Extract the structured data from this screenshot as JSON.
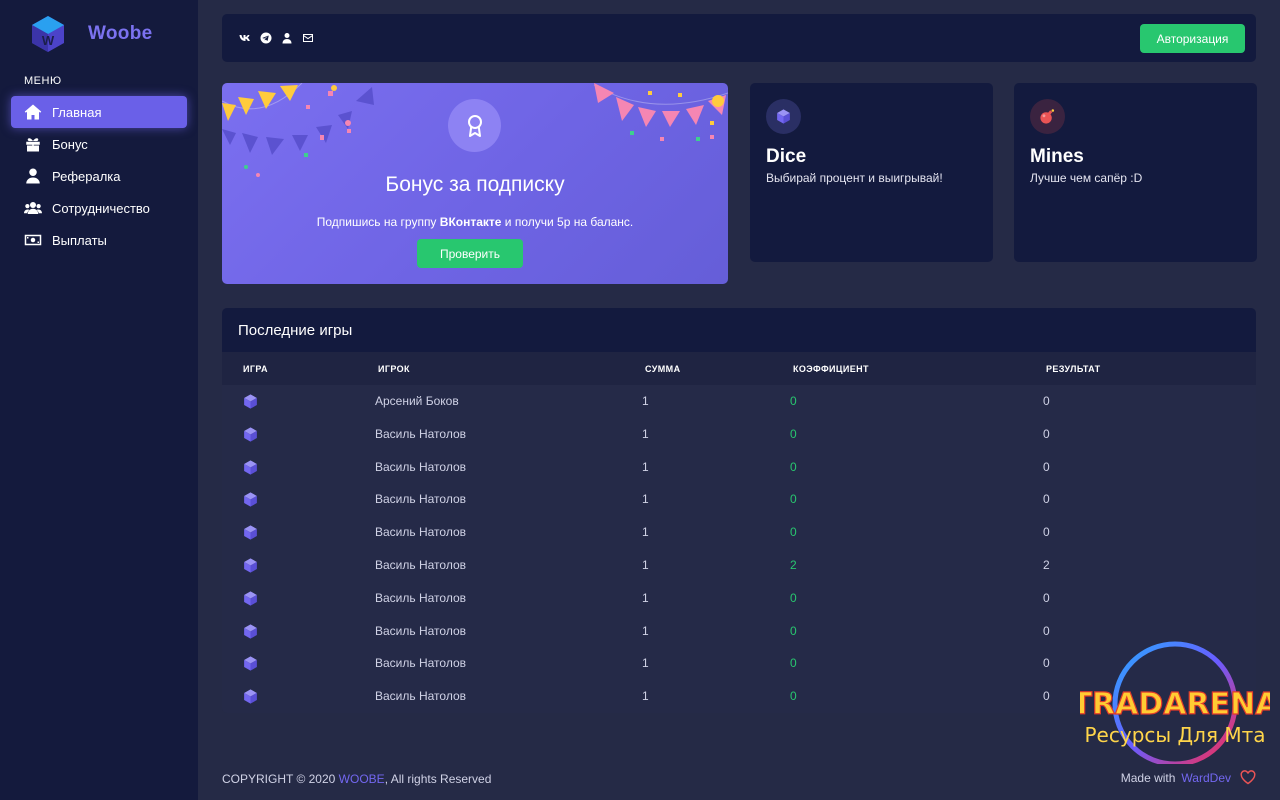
{
  "brand": {
    "name": "Woobe"
  },
  "sidebar": {
    "menu_title": "МЕНЮ",
    "items": [
      {
        "label": "Главная",
        "icon": "home-icon",
        "active": true
      },
      {
        "label": "Бонус",
        "icon": "gift-icon"
      },
      {
        "label": "Рефералка",
        "icon": "user-icon"
      },
      {
        "label": "Сотрудничество",
        "icon": "users-icon"
      },
      {
        "label": "Выплаты",
        "icon": "money-icon"
      }
    ]
  },
  "topbar": {
    "social": [
      "vk-icon",
      "telegram-icon",
      "user-icon",
      "mail-icon"
    ],
    "auth_label": "Авторизация"
  },
  "bonus": {
    "title": "Бонус за подписку",
    "text_before": "Подпишись на группу ",
    "text_bold": "ВКонтакте",
    "text_after": " и получи 5р на баланс.",
    "button": "Проверить"
  },
  "games": [
    {
      "title": "Dice",
      "desc": "Выбирай процент и выигрывай!",
      "icon": "cube-icon"
    },
    {
      "title": "Mines",
      "desc": "Лучше чем сапёр :D",
      "icon": "bomb-icon"
    }
  ],
  "recent": {
    "title": "Последние игры",
    "columns": [
      "ИГРА",
      "ИГРОК",
      "СУММА",
      "КОЭФФИЦИЕНТ",
      "РЕЗУЛЬТАТ"
    ],
    "rows": [
      {
        "game": "cube-icon",
        "player": "Арсений Боков",
        "sum": "1",
        "coef": "0",
        "result": "0"
      },
      {
        "game": "cube-icon",
        "player": "Василь Натолов",
        "sum": "1",
        "coef": "0",
        "result": "0"
      },
      {
        "game": "cube-icon",
        "player": "Василь Натолов",
        "sum": "1",
        "coef": "0",
        "result": "0"
      },
      {
        "game": "cube-icon",
        "player": "Василь Натолов",
        "sum": "1",
        "coef": "0",
        "result": "0"
      },
      {
        "game": "cube-icon",
        "player": "Василь Натолов",
        "sum": "1",
        "coef": "0",
        "result": "0"
      },
      {
        "game": "cube-icon",
        "player": "Василь Натолов",
        "sum": "1",
        "coef": "2",
        "result": "2"
      },
      {
        "game": "cube-icon",
        "player": "Василь Натолов",
        "sum": "1",
        "coef": "0",
        "result": "0"
      },
      {
        "game": "cube-icon",
        "player": "Василь Натолов",
        "sum": "1",
        "coef": "0",
        "result": "0"
      },
      {
        "game": "cube-icon",
        "player": "Василь Натолов",
        "sum": "1",
        "coef": "0",
        "result": "0"
      },
      {
        "game": "cube-icon",
        "player": "Василь Натолов",
        "sum": "1",
        "coef": "0",
        "result": "0"
      }
    ]
  },
  "footer": {
    "copyright": "COPYRIGHT © 2020 ",
    "brand": "WOOBE",
    "rights": ", All rights Reserved",
    "made_with": "Made with",
    "dev": "WardDev"
  },
  "watermark": {
    "line1": "TRADARENA",
    "line2": "Ресурсы Для Мта"
  },
  "colors": {
    "accent": "#7367f0",
    "success": "#28c76f",
    "sidebar": "#141a3d",
    "card": "#131a3e",
    "background": "#252a46"
  }
}
